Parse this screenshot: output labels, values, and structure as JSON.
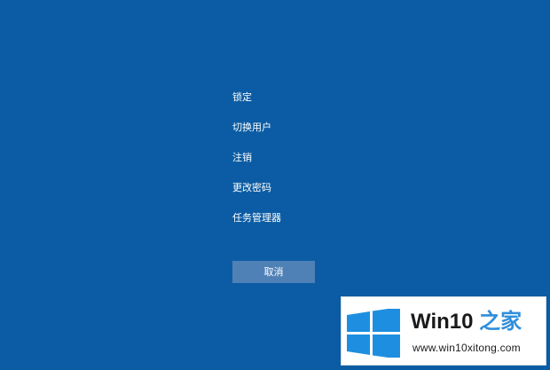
{
  "colors": {
    "background": "#0b5ca4",
    "cancel_button": "#4f81b6",
    "text": "#ffffff",
    "watermark_accent": "#2f8fdc",
    "logo_blue": "#1e8fe0"
  },
  "menu": {
    "items": [
      {
        "label": "锁定"
      },
      {
        "label": "切换用户"
      },
      {
        "label": "注销"
      },
      {
        "label": "更改密码"
      },
      {
        "label": "任务管理器"
      }
    ],
    "cancel_label": "取消"
  },
  "watermark": {
    "title_prefix": "Win10",
    "title_suffix": "之家",
    "url": "www.win10xitong.com",
    "logo_icon": "windows-logo-icon"
  }
}
